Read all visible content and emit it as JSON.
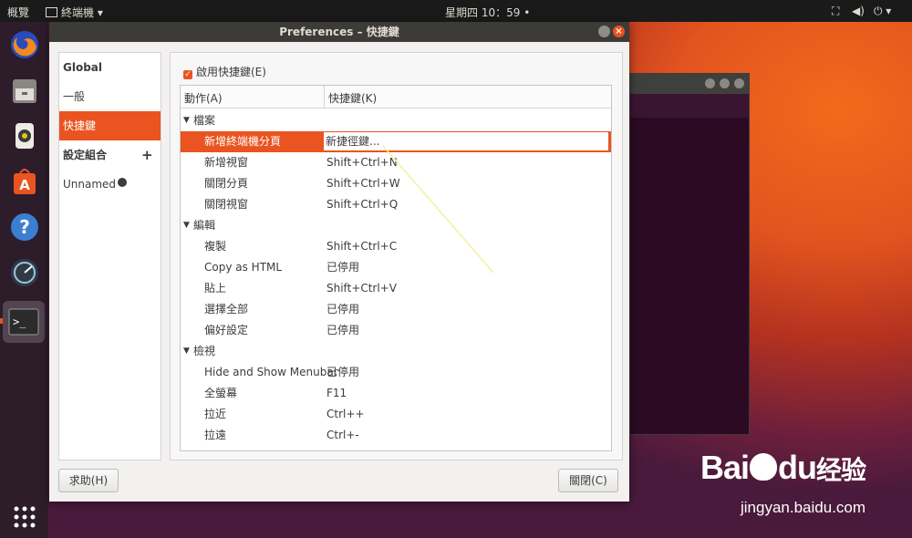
{
  "topbar": {
    "activities": "概覽",
    "app_menu": "終端機",
    "clock": "星期四 10：59"
  },
  "dialog": {
    "title": "Preferences – 快捷鍵",
    "sidebar": {
      "global_label": "Global",
      "general": "一般",
      "shortcuts": "快捷鍵",
      "profiles_label": "設定組合",
      "add": "+",
      "profile_name": "Unnamed"
    },
    "enable_shortcuts": "啟用快捷鍵(E)",
    "columns": {
      "action": "動作(A)",
      "shortcut": "快捷鍵(K)"
    },
    "groups": [
      {
        "name": "檔案",
        "rows": [
          {
            "action": "新增終端機分頁",
            "key": "新捷徑鍵..."
          },
          {
            "action": "新增視窗",
            "key": "Shift+Ctrl+N"
          },
          {
            "action": "關閉分頁",
            "key": "Shift+Ctrl+W"
          },
          {
            "action": "關閉視窗",
            "key": "Shift+Ctrl+Q"
          }
        ]
      },
      {
        "name": "編輯",
        "rows": [
          {
            "action": "複製",
            "key": "Shift+Ctrl+C"
          },
          {
            "action": "Copy as HTML",
            "key": "已停用"
          },
          {
            "action": "貼上",
            "key": "Shift+Ctrl+V"
          },
          {
            "action": "選擇全部",
            "key": "已停用"
          },
          {
            "action": "偏好設定",
            "key": "已停用"
          }
        ]
      },
      {
        "name": "檢視",
        "rows": [
          {
            "action": "Hide and Show Menubar",
            "key": "已停用"
          },
          {
            "action": "全螢幕",
            "key": "F11"
          },
          {
            "action": "拉近",
            "key": "Ctrl++"
          },
          {
            "action": "拉遠",
            "key": "Ctrl+-"
          }
        ]
      }
    ],
    "help_button": "求助(H)",
    "close_button": "關閉(C)"
  },
  "watermark": {
    "brand": "Bai",
    "brand2": "du",
    "brand_cn": "经验",
    "url": "jingyan.baidu.com"
  },
  "colors": {
    "accent": "#e95420",
    "titlebar": "#3c3b37"
  }
}
